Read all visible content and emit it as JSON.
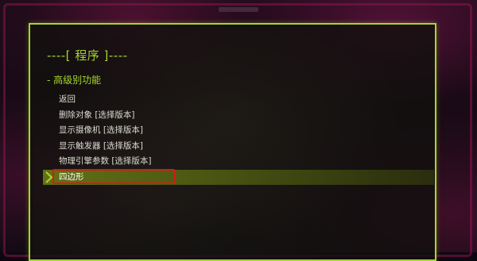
{
  "header": {
    "title": "----[ 程序 ]----",
    "section": "- 高级别功能"
  },
  "menu": {
    "items": [
      {
        "label": "返回"
      },
      {
        "label": "删除对象 [选择版本]"
      },
      {
        "label": "显示摄像机 [选择版本]"
      },
      {
        "label": "显示触发器 [选择版本]"
      },
      {
        "label": "物理引擎参数 [选择版本]"
      },
      {
        "label": "四边形"
      }
    ],
    "selected_index": 5
  },
  "colors": {
    "accent": "#a6d62e",
    "selection_outline": "#d61a1a",
    "text": "#d9dccf"
  },
  "icons": {
    "selection_marker": "chevron-right-icon"
  }
}
